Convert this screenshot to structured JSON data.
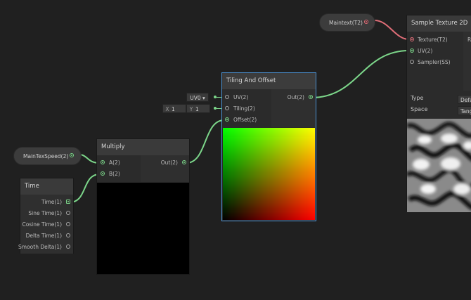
{
  "colors": {
    "background": "#202020",
    "vector_wire": "#7cd68a",
    "texture_wire": "#e06e78",
    "selection": "#4a90d0"
  },
  "properties": {
    "maintext": {
      "label": "Maintext(T2)",
      "type": "texture"
    },
    "main_tex_speed": {
      "label": "MainTexSpeed(2)",
      "type": "vector"
    }
  },
  "time_node": {
    "title": "Time",
    "outputs": [
      "Time(1)",
      "Sine Time(1)",
      "Cosine Time(1)",
      "Delta Time(1)",
      "Smooth Delta(1)"
    ]
  },
  "multiply_node": {
    "title": "Multiply",
    "inputs": [
      "A(2)",
      "B(2)"
    ],
    "output": "Out(2)"
  },
  "tiling_node": {
    "title": "Tiling And Offset",
    "inputs": [
      "UV(2)",
      "Tiling(2)",
      "Offset(2)"
    ],
    "output": "Out(2)",
    "uv_dropdown": "UV0",
    "dropdown_arrow": "▾",
    "tiling_x_label": "X",
    "tiling_x_value": "1",
    "tiling_y_label": "Y",
    "tiling_y_value": "1"
  },
  "sample_node": {
    "title": "Sample Texture 2D",
    "inputs": [
      "Texture(T2)",
      "UV(2)",
      "Sampler(SS)"
    ],
    "output_partial": "R",
    "type_label": "Type",
    "type_value": "Defa",
    "space_label": "Space",
    "space_value": "Tang"
  }
}
